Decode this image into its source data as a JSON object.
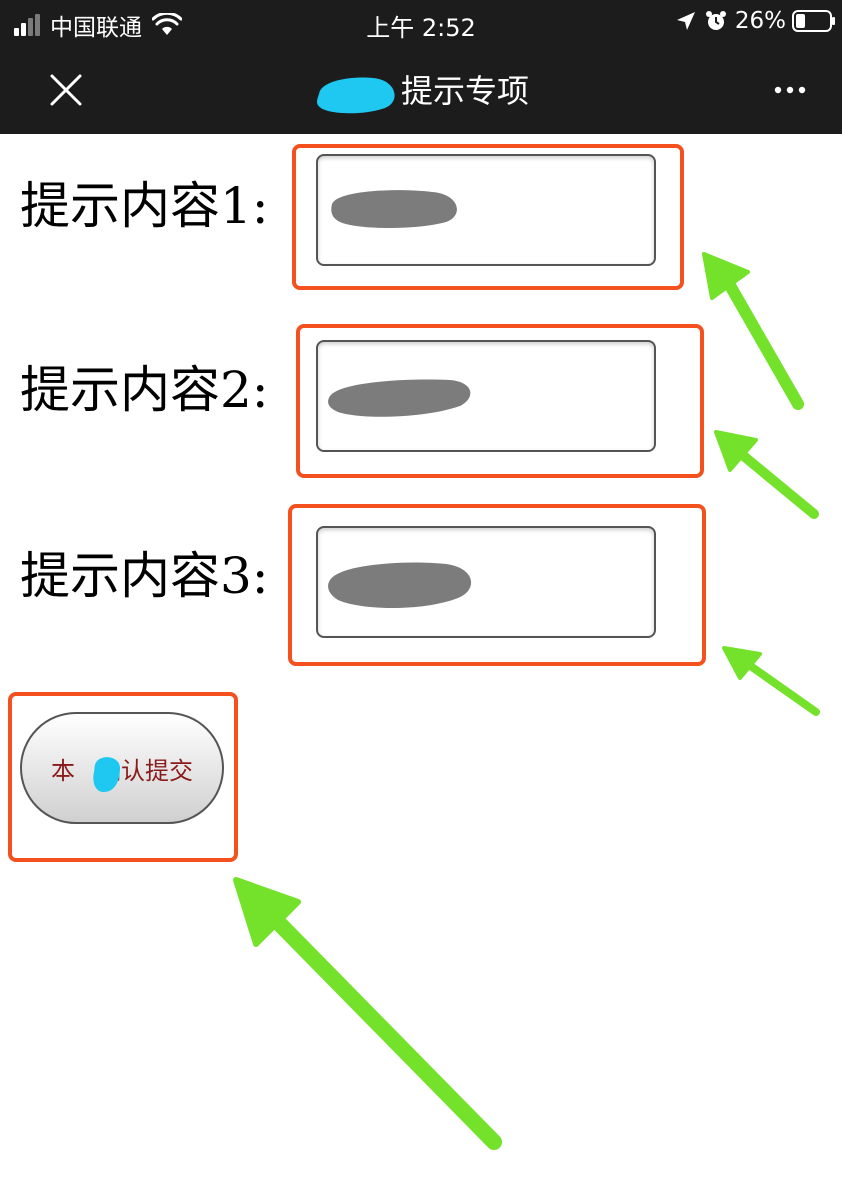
{
  "status_bar": {
    "carrier": "中国联通",
    "time": "上午 2:52",
    "battery_percent": "26%",
    "signal_bars_filled": 2,
    "signal_bars_total": 4
  },
  "nav": {
    "title_visible": "提示专项",
    "close_icon": "close-icon",
    "more_icon": "more-icon"
  },
  "form": {
    "fields": [
      {
        "label": "提示内容1:",
        "value": ""
      },
      {
        "label": "提示内容2:",
        "value": ""
      },
      {
        "label": "提示内容3:",
        "value": ""
      }
    ],
    "submit_label_prefix": "本",
    "submit_label_suffix": "确认提交"
  },
  "colors": {
    "status_bg": "#1c1c1c",
    "highlight_border": "#f4511e",
    "arrow_green": "#74e22b",
    "redaction_grey": "#7c7c7c",
    "redaction_blue": "#1ec8f0",
    "submit_text": "#8a1a1a"
  }
}
